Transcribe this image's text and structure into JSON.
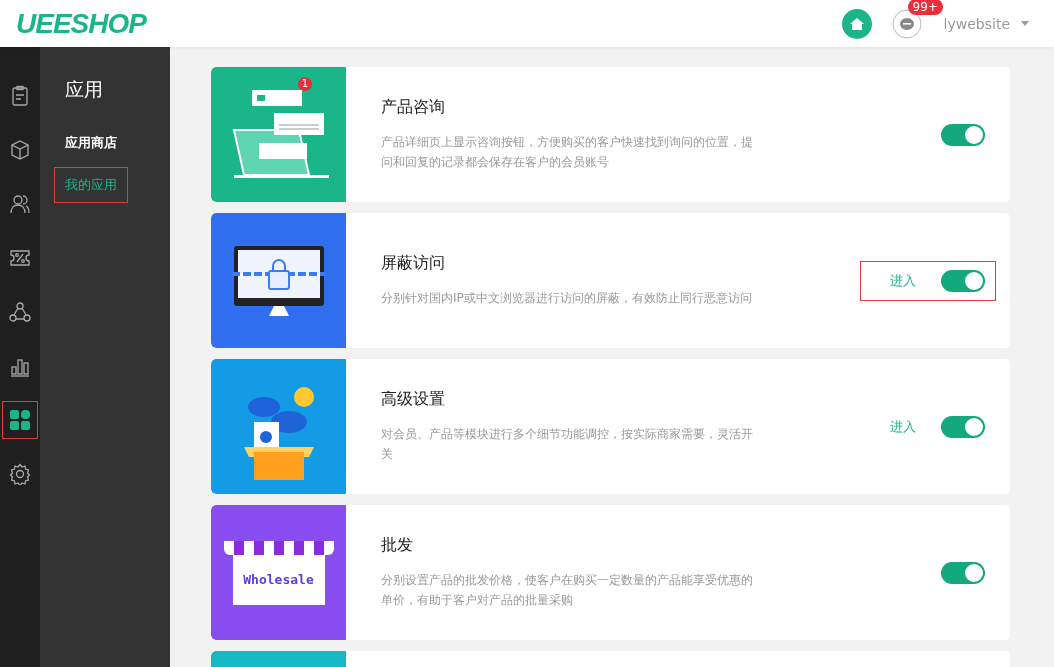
{
  "header": {
    "logo": "UEESHOP",
    "notification_badge": "99+",
    "username": "lywebsite"
  },
  "rail": [
    {
      "kind": "clipboard",
      "selected": false,
      "outlined": false
    },
    {
      "kind": "cube",
      "selected": false,
      "outlined": false
    },
    {
      "kind": "users",
      "selected": false,
      "outlined": false
    },
    {
      "kind": "coupon",
      "selected": false,
      "outlined": false
    },
    {
      "kind": "nodes",
      "selected": false,
      "outlined": false
    },
    {
      "kind": "chart",
      "selected": false,
      "outlined": false
    },
    {
      "kind": "apps",
      "selected": true,
      "outlined": true
    },
    {
      "kind": "gear",
      "selected": false,
      "outlined": false
    }
  ],
  "submenu": {
    "title": "应用",
    "items": [
      {
        "label": "应用商店",
        "selected": false,
        "outlined": false
      },
      {
        "label": "我的应用",
        "selected": true,
        "outlined": true
      }
    ]
  },
  "apps": [
    {
      "kind": "chat",
      "art_badge": "1",
      "title": "产品咨询",
      "description": "产品详细页上显示咨询按钮，方便购买的客户快速找到询问的位置，提问和回复的记录都会保存在客户的会员账号",
      "on": true,
      "outlined": false
    },
    {
      "kind": "lock",
      "title": "屏蔽访问",
      "description": "分别针对国内IP或中文浏览器进行访问的屏蔽，有效防止同行恶意访问",
      "enter_link": "进入",
      "on": true,
      "outlined": true
    },
    {
      "kind": "box",
      "title": "高级设置",
      "description": "对会员、产品等模块进行多个细节功能调控，按实际商家需要，灵活开关",
      "enter_link": "进入",
      "on": true,
      "outlined": false
    },
    {
      "kind": "store",
      "art_text": "Wholesale",
      "title": "批发",
      "description": "分别设置产品的批发价格，使客户在购买一定数量的产品能享受优惠的单价，有助于客户对产品的批量采购",
      "on": true,
      "outlined": false
    }
  ]
}
